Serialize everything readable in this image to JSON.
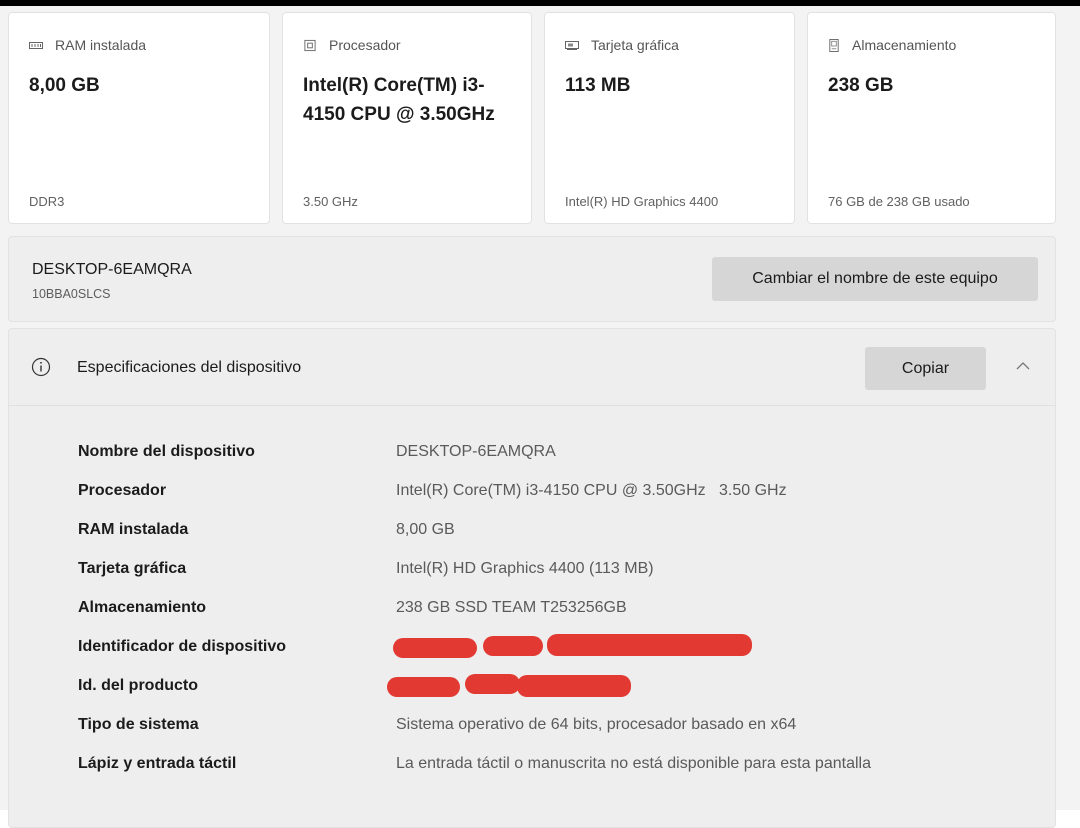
{
  "cards": [
    {
      "icon": "ram-icon",
      "title": "RAM instalada",
      "value": "8,00 GB",
      "footer": "DDR3"
    },
    {
      "icon": "processor-icon",
      "title": "Procesador",
      "value": "Intel(R) Core(TM) i3-4150 CPU @ 3.50GHz",
      "footer": "3.50 GHz"
    },
    {
      "icon": "graphics-card-icon",
      "title": "Tarjeta gráfica",
      "value": "113 MB",
      "footer": "Intel(R) HD Graphics 4400"
    },
    {
      "icon": "storage-icon",
      "title": "Almacenamiento",
      "value": "238 GB",
      "footer": "76 GB de 238 GB usado"
    }
  ],
  "device": {
    "name": "DESKTOP-6EAMQRA",
    "model": "10BBA0SLCS",
    "rename_label": "Cambiar el nombre de este equipo"
  },
  "specs": {
    "title": "Especificaciones del dispositivo",
    "copy_label": "Copiar",
    "rows": [
      {
        "label": "Nombre del dispositivo",
        "value": "DESKTOP-6EAMQRA"
      },
      {
        "label": "Procesador",
        "value": "Intel(R) Core(TM) i3-4150 CPU @ 3.50GHz   3.50 GHz"
      },
      {
        "label": "RAM instalada",
        "value": "8,00 GB"
      },
      {
        "label": "Tarjeta gráfica",
        "value": "Intel(R) HD Graphics 4400 (113 MB)"
      },
      {
        "label": "Almacenamiento",
        "value": "238 GB SSD TEAM T253256GB"
      },
      {
        "label": "Identificador de dispositivo",
        "value": ""
      },
      {
        "label": "Id. del producto",
        "value": ""
      },
      {
        "label": "Tipo de sistema",
        "value": "Sistema operativo de 64 bits, procesador basado en x64"
      },
      {
        "label": "Lápiz y entrada táctil",
        "value": "La entrada táctil o manuscrita no está disponible para esta pantalla"
      }
    ]
  },
  "colors": {
    "redaction": "#e23a32",
    "button": "#d6d6d6",
    "panel": "#eeeeee"
  }
}
